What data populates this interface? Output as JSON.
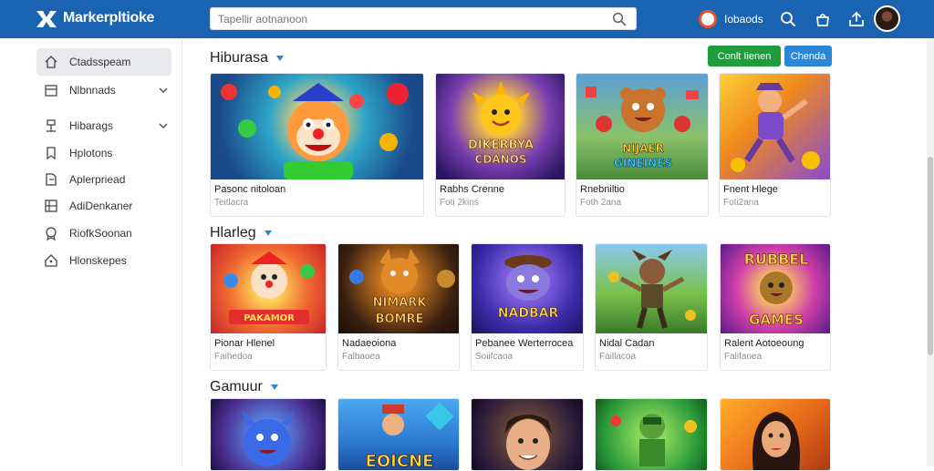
{
  "header": {
    "brand": "Markerpltioke",
    "search_placeholder": "Tapellir aotnanoon",
    "notif_label": "Iobaods"
  },
  "sidebar": {
    "items": [
      {
        "label": "Ctadsspeam",
        "icon": "home-icon",
        "active": true
      },
      {
        "label": "Nlbnnads",
        "icon": "category-icon",
        "chevron": true
      },
      {
        "label": "Hibarags",
        "icon": "pin-icon",
        "chevron": true
      },
      {
        "label": "Hplotons",
        "icon": "bookmark-icon"
      },
      {
        "label": "Aplerpriead",
        "icon": "doc-icon"
      },
      {
        "label": "AdiDenkaner",
        "icon": "grid-icon"
      },
      {
        "label": "RiofkSoonan",
        "icon": "badge-icon"
      },
      {
        "label": "Hlonskepes",
        "icon": "tag-icon"
      }
    ]
  },
  "actions": {
    "primary": "Conlt Iienen",
    "secondary": "Chenda"
  },
  "sections": [
    {
      "title": "Hiburasa",
      "cards": [
        {
          "title": "Pasonc nitoloan",
          "sub": "Teitlacra",
          "art": "clown"
        },
        {
          "title": "Rabhs Crenne",
          "sub": "Foti 2kins",
          "art": "sun",
          "banner": "DIKERBYA\nCDANOS"
        },
        {
          "title": "Rnebniltio",
          "sub": "Foth 2ana",
          "art": "bear",
          "banner": "NIJAER\nGINEINES"
        },
        {
          "title": "Fnent Hlege",
          "sub": "Foti2ana",
          "art": "runner"
        }
      ]
    },
    {
      "title": "Hlarleg",
      "cards": [
        {
          "title": "Pionar Hlenel",
          "sub": "Faihedoa",
          "art": "clown2",
          "banner": "PAKAMOR"
        },
        {
          "title": "Nadaeoiona",
          "sub": "Falbaoea",
          "art": "fox",
          "banner": "NIMARK\nBOMRE"
        },
        {
          "title": "Pebanee Werterrocea",
          "sub": "Soiifcaoa",
          "art": "hippo",
          "banner": "NADBAR"
        },
        {
          "title": "Nidal Cadan",
          "sub": "Faillacoa",
          "art": "goblin"
        },
        {
          "title": "Ralent Aotoeoung",
          "sub": "Falifaoea",
          "art": "blob",
          "banner": "RUBBEL\nGAMES"
        }
      ]
    },
    {
      "title": "Gamuur",
      "cards": [
        {
          "title": "",
          "sub": "",
          "art": "blue-monster"
        },
        {
          "title": "",
          "sub": "",
          "art": "hero",
          "banner": "EOICNE"
        },
        {
          "title": "",
          "sub": "",
          "art": "man"
        },
        {
          "title": "",
          "sub": "",
          "art": "elf"
        },
        {
          "title": "",
          "sub": "",
          "art": "woman"
        }
      ]
    }
  ],
  "colors": {
    "header": "#1a63b0",
    "primary_btn": "#1f9c3c",
    "secondary_btn": "#2a86d6",
    "caret": "#2a86d6"
  }
}
